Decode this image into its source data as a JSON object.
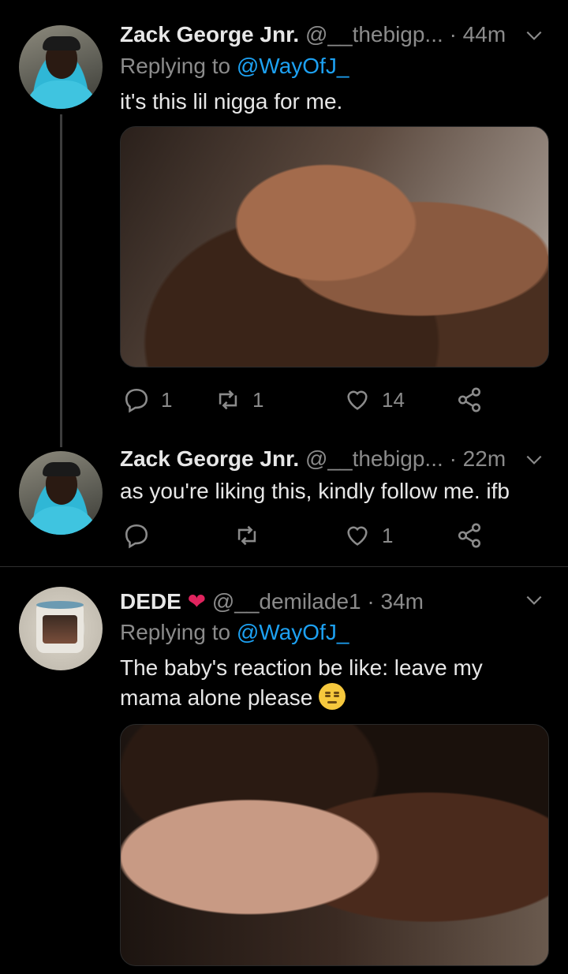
{
  "tweets": [
    {
      "name": "Zack George Jnr.",
      "handle": "@__thebigp...",
      "dot": "·",
      "time": "44m",
      "replying_prefix": "Replying to ",
      "replying_to": "@WayOfJ_",
      "text": "it's this lil nigga for me.",
      "actions": {
        "reply": "1",
        "retweet": "1",
        "like": "14"
      }
    },
    {
      "name": "Zack George Jnr.",
      "handle": "@__thebigp...",
      "dot": "·",
      "time": "22m",
      "text": "as you're liking this, kindly follow me. ifb",
      "actions": {
        "reply": "",
        "retweet": "",
        "like": "1"
      }
    },
    {
      "name": "DEDE",
      "handle": "@__demilade1",
      "dot": "·",
      "time": "34m",
      "replying_prefix": "Replying to ",
      "replying_to": "@WayOfJ_",
      "text_line1": "The baby's reaction be like: leave my",
      "text_line2": "mama alone please"
    }
  ],
  "icons": [
    "reply-icon",
    "retweet-icon",
    "like-icon",
    "share-icon",
    "chevron-down-icon",
    "heart-emoji-icon",
    "unamused-emoji-icon"
  ],
  "colors": {
    "background": "#000000",
    "mention": "#1da1f2",
    "secondary_text": "#8b8b8b",
    "heart": "#e0245e"
  }
}
